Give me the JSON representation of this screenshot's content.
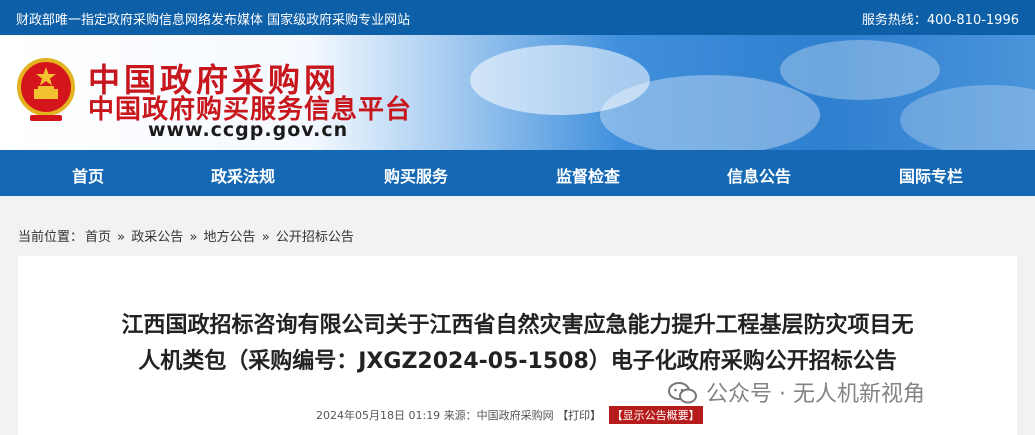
{
  "topbar": {
    "left_text": "财政部唯一指定政府采购信息网络发布媒体 国家级政府采购专业网站",
    "hotline": "服务热线：400-810-1996"
  },
  "logo": {
    "name_cn": "中国政府采购网",
    "subtitle_cn": "中国政府购买服务信息平台",
    "url": "www.ccgp.gov.cn"
  },
  "nav": {
    "items": [
      {
        "label": "首页"
      },
      {
        "label": "政采法规"
      },
      {
        "label": "购买服务"
      },
      {
        "label": "监督检查"
      },
      {
        "label": "信息公告"
      },
      {
        "label": "国际专栏"
      }
    ]
  },
  "breadcrumb": {
    "prefix": "当前位置：",
    "items": [
      "首页",
      "政采公告",
      "地方公告",
      "公开招标公告"
    ],
    "separator": "»"
  },
  "article": {
    "title_line1": "江西国政招标咨询有限公司关于江西省自然灾害应急能力提升工程基层防灾项目无",
    "title_line2": "人机类包（采购编号：JXGZ2024-05-1508）电子化政府采购公开招标公告",
    "date": "2024年05月18日 01:19",
    "source": "来源：中国政府采购网",
    "print": "【打印】",
    "summary": "【显示公告概要】"
  },
  "watermark": {
    "text": "公众号 · 无人机新视角"
  },
  "colors": {
    "topbar": "#0d5fa8",
    "nav": "#1468b4",
    "logo_red": "#c8161d",
    "badge_red": "#b71c1c"
  }
}
